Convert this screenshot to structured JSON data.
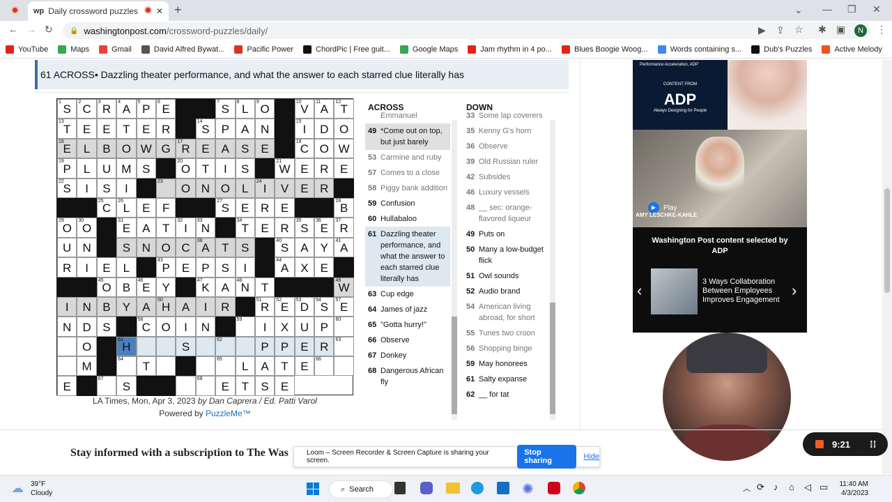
{
  "browser": {
    "tab_title": "Daily crossword puzzles free",
    "tab_fav": "wp",
    "url_host": "washingtonpost.com",
    "url_path": "/crossword-puzzles/daily/",
    "profile": "N"
  },
  "bookmarks": [
    {
      "label": "YouTube",
      "color": "#e62117"
    },
    {
      "label": "Maps",
      "color": "#34a853"
    },
    {
      "label": "Gmail",
      "color": "#ea4335"
    },
    {
      "label": "David Alfred Bywat...",
      "color": "#555"
    },
    {
      "label": "Pacific Power",
      "color": "#e0301e"
    },
    {
      "label": "ChordPic | Free guit...",
      "color": "#111"
    },
    {
      "label": "Google Maps",
      "color": "#34a853"
    },
    {
      "label": "Jam rhythm in 4 po...",
      "color": "#e62117"
    },
    {
      "label": "Blues Boogie Woog...",
      "color": "#e62117"
    },
    {
      "label": "Words containing s...",
      "color": "#4285f4"
    },
    {
      "label": "Dub's Puzzles",
      "color": "#111"
    },
    {
      "label": "Active Melody",
      "color": "#f4511e"
    }
  ],
  "banner": {
    "clue_ref": "61 ACROSS",
    "clue_text": " • Dazzling theater performance, and what the answer to each starred clue literally has"
  },
  "grid": {
    "rows": [
      "SCRAPE##SLO#VAT",
      "TEETER#SPAN#IDO",
      "ELBOWGREASE#COW",
      "PLUMS#OTIS#WERE",
      "SISI#_ONOLIVER",
      "###CLEF##SERE##",
      "BOO#EATIN#TERSE",
      "RUN#SNOCATS#SAY",
      "ARIEL#PEPSI#AXE",
      "###OBEY#KANT###",
      "WINBYAHAIR#REDS",
      "ENDS#COIN#_IXUP",
      "__O#H__S___PPER",
      "__M#_T_#__LATE",
      "__E#_S##__ETSE"
    ],
    "numbers": {
      "0,0": "1",
      "0,1": "2",
      "0,2": "3",
      "0,3": "4",
      "0,4": "5",
      "0,5": "6",
      "0,8": "7",
      "0,9": "8",
      "0,10": "9",
      "0,12": "10",
      "0,13": "11",
      "0,14": "12",
      "1,0": "13",
      "1,7": "14",
      "1,12": "15",
      "2,0": "16",
      "2,6": "17",
      "2,12": "18",
      "3,0": "19",
      "3,6": "20",
      "3,11": "21",
      "4,0": "22",
      "4,5": "23",
      "4,10": "24",
      "5,3": "25",
      "5,4": "26",
      "5,9": "27",
      "6,0": "28",
      "6,1": "29",
      "6,2": "30",
      "6,4": "31",
      "6,7": "32",
      "6,8": "33",
      "6,10": "34",
      "6,13": "35",
      "6,14": "36",
      "7,0": "37",
      "7,8": "38",
      "7,11": "39",
      "7,12": "40",
      "8,0": "41",
      "8,5": "42",
      "8,6": "43",
      "8,12": "44",
      "9,3": "45",
      "9,5": "46",
      "9,8": "47",
      "9,10": "48",
      "10,0": "49",
      "10,6": "50",
      "10,11": "51",
      "10,12": "52",
      "10,13": "53",
      "10,14": "54",
      "11,0": "57",
      "11,5": "58",
      "11,10": "59",
      "12,0": "60",
      "12,4": "61",
      "12,9": "62",
      "13,0": "63",
      "13,4": "64",
      "13,9": "65",
      "14,0": "66",
      "14,4": "67",
      "14,9": "68"
    },
    "shaded": [
      "2,0",
      "2,1",
      "2,2",
      "2,3",
      "2,4",
      "2,5",
      "2,6",
      "2,7",
      "2,8",
      "2,9",
      "2,10",
      "4,5",
      "4,6",
      "4,7",
      "4,8",
      "4,9",
      "4,10",
      "4,11",
      "4,12",
      "4,13",
      "4,14",
      "7,4",
      "7,5",
      "7,6",
      "7,7",
      "7,8",
      "7,9",
      "7,10",
      "10,0",
      "10,1",
      "10,2",
      "10,3",
      "10,4",
      "10,5",
      "10,6",
      "10,7",
      "10,8",
      "10,9"
    ],
    "word": [
      "12,5",
      "12,6",
      "12,7",
      "12,8",
      "12,9",
      "12,10",
      "12,11",
      "12,12",
      "12,13",
      "12,14"
    ],
    "active": "12,4"
  },
  "credit": {
    "line1": "LA Times, Mon, Apr 3, 2023 ",
    "byline": "by Dan Caprera / Ed. Patti Varol",
    "powered": "Powered by ",
    "puzzleme": "PuzzleMe™"
  },
  "across": {
    "title": "ACROSS",
    "clues": [
      {
        "num": "",
        "text": "Emmanuel",
        "style": "dim"
      },
      {
        "num": "49",
        "text": "*Come out on top, but just barely",
        "style": "gr"
      },
      {
        "num": "53",
        "text": "Carmine and ruby",
        "style": "dim"
      },
      {
        "num": "57",
        "text": "Comes to a close",
        "style": "dim"
      },
      {
        "num": "58",
        "text": "Piggy bank addition",
        "style": "dim"
      },
      {
        "num": "59",
        "text": "Confusion",
        "style": ""
      },
      {
        "num": "60",
        "text": "Hullabaloo",
        "style": ""
      },
      {
        "num": "61",
        "text": "Dazzling theater performance, and what the answer to each starred clue literally has",
        "style": "hl"
      },
      {
        "num": "63",
        "text": "Cup edge",
        "style": ""
      },
      {
        "num": "64",
        "text": "James of jazz",
        "style": ""
      },
      {
        "num": "65",
        "text": "\"Gotta hurry!\"",
        "style": ""
      },
      {
        "num": "66",
        "text": "Observe",
        "style": ""
      },
      {
        "num": "67",
        "text": "Donkey",
        "style": ""
      },
      {
        "num": "68",
        "text": "Dangerous African fly",
        "style": ""
      }
    ]
  },
  "down": {
    "title": "DOWN",
    "clues": [
      {
        "num": "33",
        "text": "Some lap coverers",
        "style": "dim"
      },
      {
        "num": "35",
        "text": "Kenny G's horn",
        "style": "dim"
      },
      {
        "num": "36",
        "text": "Observe",
        "style": "dim"
      },
      {
        "num": "39",
        "text": "Old Russian ruler",
        "style": "dim"
      },
      {
        "num": "42",
        "text": "Subsides",
        "style": "dim"
      },
      {
        "num": "46",
        "text": "Luxury vessels",
        "style": "dim"
      },
      {
        "num": "48",
        "text": "__ sec: orange-flavored liqueur",
        "style": "dim"
      },
      {
        "num": "49",
        "text": "Puts on",
        "style": ""
      },
      {
        "num": "50",
        "text": "Many a low-budget flick",
        "style": ""
      },
      {
        "num": "51",
        "text": "Owl sounds",
        "style": ""
      },
      {
        "num": "52",
        "text": "Audio brand",
        "style": ""
      },
      {
        "num": "54",
        "text": "American living abroad, for short",
        "style": "dim"
      },
      {
        "num": "55",
        "text": "Tunes two croon",
        "style": "dim"
      },
      {
        "num": "56",
        "text": "Shopping binge",
        "style": "dim"
      },
      {
        "num": "59",
        "text": "May honorees",
        "style": ""
      },
      {
        "num": "61",
        "text": "Salty expanse",
        "style": ""
      },
      {
        "num": "62",
        "text": "__ for tat",
        "style": ""
      }
    ]
  },
  "ad": {
    "header": "Performance Acceleration, ADP",
    "content_from": "CONTENT FROM",
    "brand": "ADP",
    "tagline": "Always Designing for People",
    "play": "Play",
    "person": "AMY LESCHKE-KAHLE",
    "selected": "Washington Post content selected by ADP",
    "article": "3 Ways Collaboration Between Employees Improves Engagement"
  },
  "footer": {
    "subscribe": "Stay informed with a subscription to The Was"
  },
  "loom": {
    "msg": "Loom – Screen Recorder & Screen Capture is sharing your screen.",
    "stop": "Stop sharing",
    "hide": "Hide",
    "timer": "9:21"
  },
  "taskbar": {
    "temp": "39°F",
    "cond": "Cloudy",
    "search": "Search",
    "time": "11:40 AM",
    "date": "4/3/2023"
  }
}
